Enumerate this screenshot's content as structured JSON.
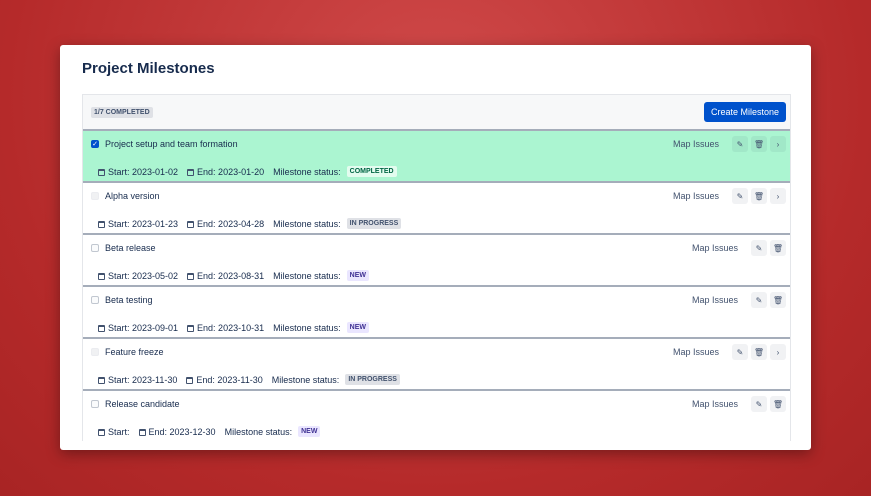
{
  "title": "Project Milestones",
  "summary": "1/7 COMPLETED",
  "create_label": "Create Milestone",
  "map_label": "Map Issues",
  "status_label": "Milestone status:",
  "milestones": [
    {
      "name": "Project setup and team formation",
      "start": "Start: 2023-01-02",
      "end": "End: 2023-01-20",
      "status": "COMPLETED",
      "checked": true,
      "expand": true
    },
    {
      "name": "Alpha version",
      "start": "Start: 2023-01-23",
      "end": "End: 2023-04-28",
      "status": "IN PROGRESS",
      "checked": false,
      "expand": true
    },
    {
      "name": "Beta release",
      "start": "Start: 2023-05-02",
      "end": "End: 2023-08-31",
      "status": "NEW",
      "checked": false,
      "expand": false
    },
    {
      "name": "Beta testing",
      "start": "Start: 2023-09-01",
      "end": "End: 2023-10-31",
      "status": "NEW",
      "checked": false,
      "expand": false
    },
    {
      "name": "Feature freeze",
      "start": "Start: 2023-11-30",
      "end": "End: 2023-11-30",
      "status": "IN PROGRESS",
      "checked": false,
      "expand": true
    },
    {
      "name": "Release candidate",
      "start": "Start:",
      "end": "End: 2023-12-30",
      "status": "NEW",
      "checked": false,
      "expand": false
    }
  ]
}
